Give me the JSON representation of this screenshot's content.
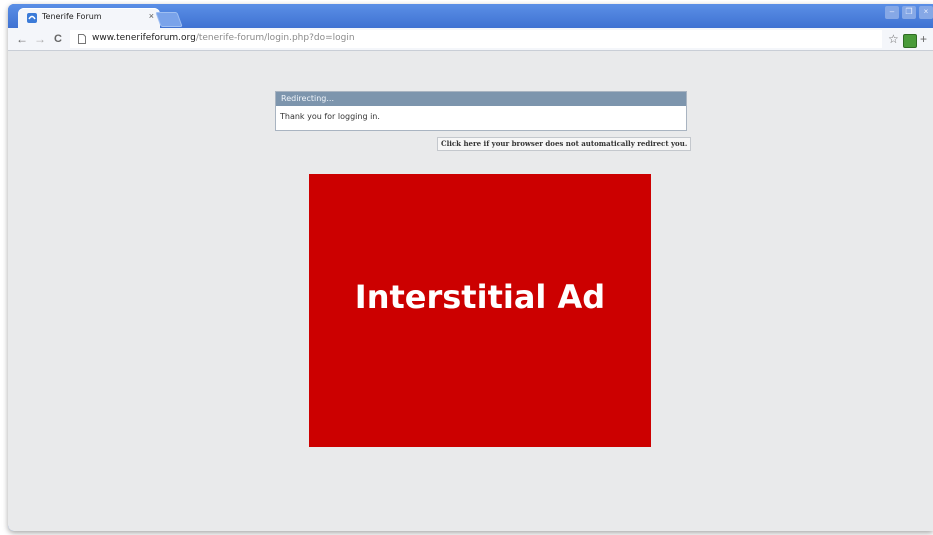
{
  "browser": {
    "tab": {
      "title": "Tenerife Forum",
      "close_glyph": "×",
      "favicon": "forum-favicon-icon"
    },
    "window_controls": [
      "–",
      "❐",
      "×"
    ],
    "toolbar": {
      "back_glyph": "←",
      "forward_glyph": "→",
      "reload_glyph": "C",
      "url_host": "www.tenerifeforum.org",
      "url_path": "/tenerife-forum/login.php?do=login",
      "star_glyph": "☆",
      "wrench_glyph": "+"
    }
  },
  "page": {
    "redirect_title": "Redirecting...",
    "redirect_message": "Thank you for logging in.",
    "redirect_link": "Click here if your browser does not automatically redirect you.",
    "ad_label": "Interstitial Ad"
  },
  "colors": {
    "ad_background": "#cc0000",
    "window_frame": "#2f63c6",
    "page_background": "#e9eaeb"
  }
}
